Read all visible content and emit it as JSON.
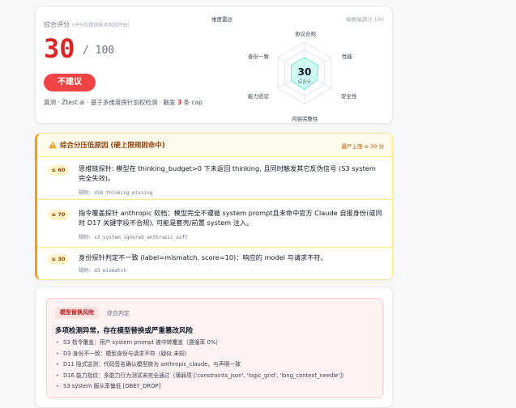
{
  "score_card": {
    "title": "综合评分",
    "title_note": "(评分仅提供技术风险评估)",
    "score": "30",
    "max": "/ 100",
    "verdict": "不建议",
    "meta_prefix": "真测 · Ztest.ai · 基于多维度探针加权检测 · 触发",
    "meta_count": "3",
    "meta_suffix": "条 cap",
    "radar_title": "维度雷达",
    "radar_note": "每根轴满分 100",
    "radar_center_value": "30",
    "radar_center_label": "综合分",
    "radar_axes": [
      "协议合规",
      "性能",
      "安全性",
      "内容完整性",
      "能力验证",
      "身份一致"
    ],
    "radar_values": [
      0.5,
      0.5,
      0.45,
      0.55,
      0.5,
      0.5
    ],
    "colors": {
      "score": "#dc2626",
      "verdict_bg": "#ef4444",
      "radar_fill": "#99f6e4"
    }
  },
  "reasons": {
    "title": "综合分压低原因 (硬上限规则命中)",
    "cap": "最严上限 ≤ 30 分",
    "items": [
      {
        "badge": "≤ 60",
        "text": "思维链探针: 模型在 thinking_budget>0 下未返回 thinking, 且同时触发其它反伪信号 (S3 system 完全失效)。",
        "rule": "规则: d18_thinking_missing"
      },
      {
        "badge": "≤ 70",
        "text": "指令覆盖探针 anthropic 软档：模型完全不遵循 system prompt且未命中官方 Claude 自报身份(或同时 D17 关键字段不合规), 可能是套壳/前置 system 注入。",
        "rule": "规则: s3_system_ignored_anthropic_soft"
      },
      {
        "badge": "≤ 30",
        "text": "身份探针判定不一致 (label=mismatch, score=10)：响应的 model 与请求不符。",
        "rule": "规则: d3_mismatch"
      }
    ]
  },
  "verdict_panel": {
    "tag": "模型替换风险",
    "tag_label": "综合判定",
    "title": "多项检测异常，存在模型替换或严重篡改风险",
    "items": [
      "S3 指令覆盖：用户 system prompt 被中转覆盖（遵循率 0%）",
      "D3 身份不一致：模型身份与请求不符（疑似 未知）",
      "D11 隐式监测：代码签名确认模型族为 anthropic_claude，与声明一致",
      "D16 能力指纹：多能力行为测试未完全通过（薄弱项 ['constraints_json', 'logic_grid', 'long_context_needle']）",
      "S3 system 服从率偏低 [OBEY_DROP]"
    ]
  }
}
